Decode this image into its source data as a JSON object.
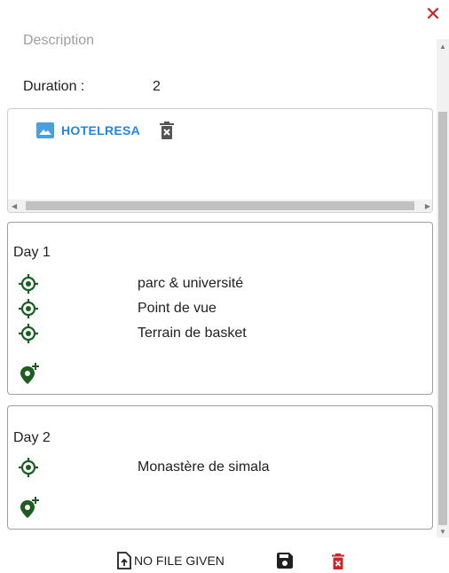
{
  "header": {
    "close_symbol": "✕"
  },
  "form": {
    "description_placeholder": "Description",
    "duration_label": "Duration :",
    "duration_value": "2"
  },
  "files": [
    {
      "name": "HOTELRESA",
      "icon": "image-icon"
    }
  ],
  "days": [
    {
      "title": "Day 1",
      "places": [
        "parc & université",
        "Point de vue",
        "Terrain de basket"
      ]
    },
    {
      "title": "Day 2",
      "places": [
        "Monastère de simala"
      ]
    }
  ],
  "footer": {
    "upload_label": "NO FILE GIVEN"
  },
  "colors": {
    "accent_blue": "#1e88e5",
    "place_green": "#1b5e20",
    "danger_red": "#c62828"
  }
}
